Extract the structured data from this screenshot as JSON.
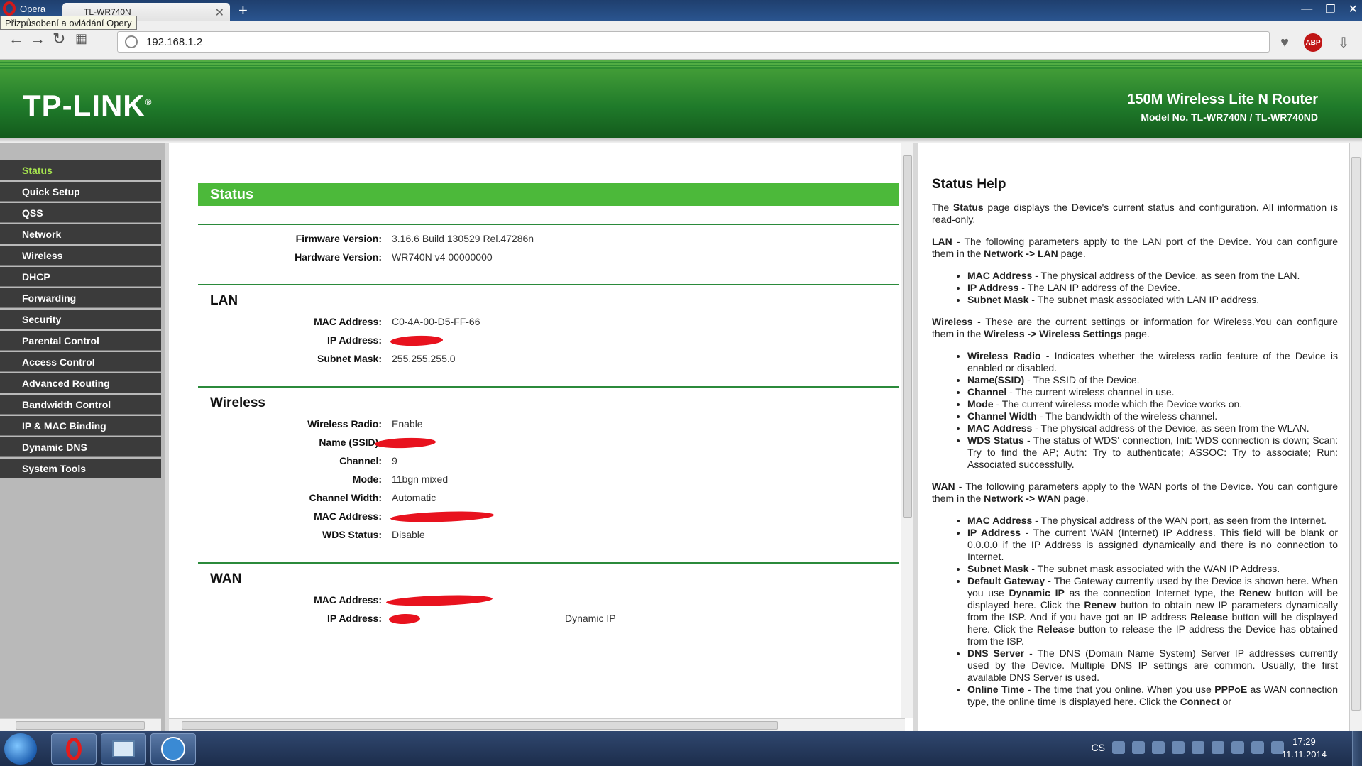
{
  "browser": {
    "app_name": "Opera",
    "tab_title": "TL-WR740N",
    "tooltip": "Přizpůsobení a ovládání Opery",
    "url": "192.168.1.2",
    "new_tab": "+",
    "abp_label": "ABP"
  },
  "header": {
    "logo": "TP-LINK",
    "logo_mark": "®",
    "product": "150M Wireless Lite N Router",
    "model": "Model No. TL-WR740N / TL-WR740ND"
  },
  "menu": [
    "Status",
    "Quick Setup",
    "QSS",
    "Network",
    "Wireless",
    "DHCP",
    "Forwarding",
    "Security",
    "Parental Control",
    "Access Control",
    "Advanced Routing",
    "Bandwidth Control",
    "IP & MAC Binding",
    "Dynamic DNS",
    "System Tools"
  ],
  "status": {
    "title": "Status",
    "firmware_label": "Firmware Version:",
    "firmware_value": "3.16.6 Build 130529 Rel.47286n",
    "hardware_label": "Hardware Version:",
    "hardware_value": "WR740N v4 00000000",
    "lan": {
      "title": "LAN",
      "mac_label": "MAC Address:",
      "mac_value": "C0-4A-00-D5-FF-66",
      "ip_label": "IP Address:",
      "subnet_label": "Subnet Mask:",
      "subnet_value": "255.255.255.0"
    },
    "wireless": {
      "title": "Wireless",
      "radio_label": "Wireless Radio:",
      "radio_value": "Enable",
      "ssid_label": "Name (SSID):",
      "channel_label": "Channel:",
      "channel_value": "9",
      "mode_label": "Mode:",
      "mode_value": "11bgn mixed",
      "width_label": "Channel Width:",
      "width_value": "Automatic",
      "mac_label": "MAC Address:",
      "wds_label": "WDS Status:",
      "wds_value": "Disable"
    },
    "wan": {
      "title": "WAN",
      "mac_label": "MAC Address:",
      "ip_label": "IP Address:",
      "ip_type": "Dynamic IP"
    }
  },
  "help": {
    "title": "Status Help"
  },
  "taskbar": {
    "lang": "CS",
    "time": "17:29",
    "date": "11.11.2014"
  },
  "colors": {
    "header_green": "#1f7a2a",
    "status_bar": "#4cb93a",
    "menu_bg": "#3b3b3b",
    "menu_active": "#a6e44f",
    "redaction": "#e8121e"
  }
}
